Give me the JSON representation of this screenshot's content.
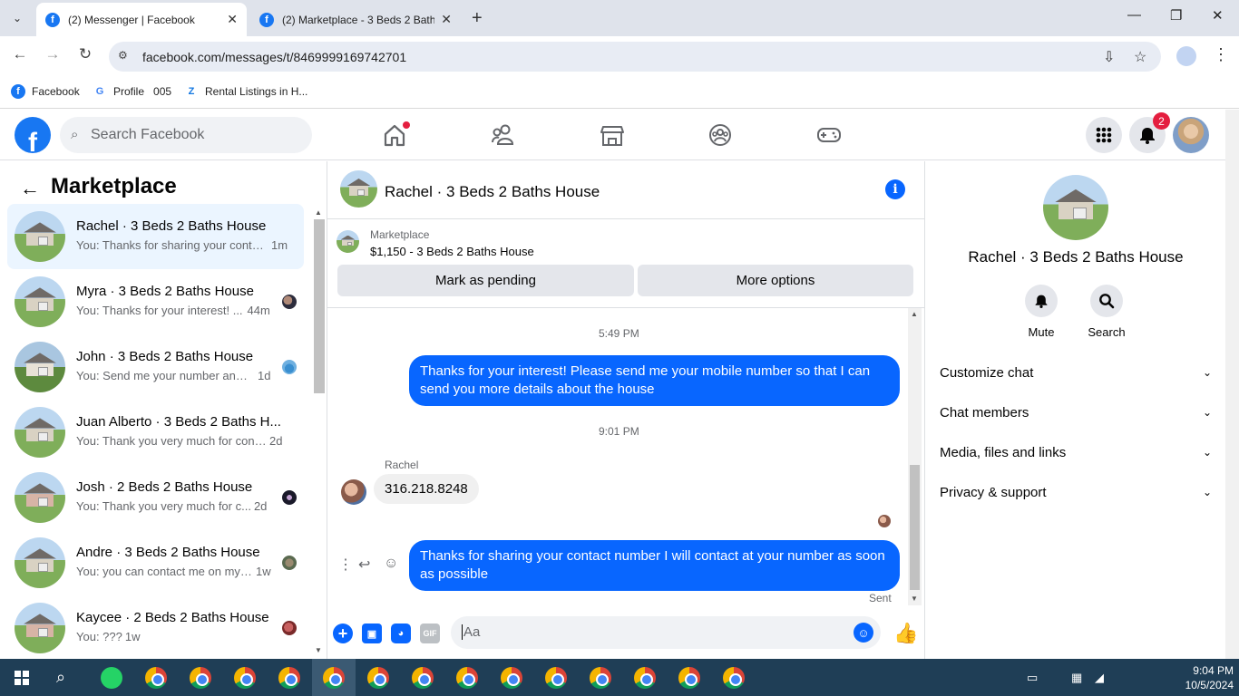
{
  "browser": {
    "tabs": [
      {
        "title": "(2) Messenger | Facebook",
        "active": true
      },
      {
        "title": "(2) Marketplace - 3 Beds 2 Bath",
        "active": false
      }
    ],
    "url": "facebook.com/messages/t/8469999169742701",
    "bookmarks": [
      {
        "label": "Facebook",
        "icon": "facebook-icon"
      },
      {
        "label": "Profile   005",
        "icon": "google-icon"
      },
      {
        "label": "Rental Listings in H...",
        "icon": "zillow-icon"
      }
    ]
  },
  "fb_header": {
    "search_placeholder": "Search Facebook",
    "notification_count": "2",
    "colors": {
      "brand": "#1877f2",
      "badge": "#e41e3f"
    }
  },
  "left_panel": {
    "title": "Marketplace",
    "conversations": [
      {
        "name": "Rachel · 3 Beds 2 Baths House",
        "preview": "You: Thanks for sharing your conta...",
        "time": "1m",
        "selected": true
      },
      {
        "name": "Myra · 3 Beds 2 Baths House",
        "preview": "You: Thanks for your interest! ...",
        "time": "44m"
      },
      {
        "name": "John · 3 Beds 2 Baths House",
        "preview": "You: Send me your number and ...",
        "time": "1d"
      },
      {
        "name": "Juan Alberto · 3 Beds 2 Baths H...",
        "preview": "You: Thank you very much for cont...",
        "time": "2d"
      },
      {
        "name": "Josh · 2 Beds 2 Baths House",
        "preview": "You: Thank you very much for c...",
        "time": "2d"
      },
      {
        "name": "Andre · 3 Beds 2 Baths House",
        "preview": "You: you can contact me on my ...",
        "time": "1w"
      },
      {
        "name": "Kaycee · 2 Beds 2 Baths House",
        "preview": "You: ???",
        "time": "1w"
      }
    ]
  },
  "chat": {
    "title": "Rachel · 3 Beds 2 Baths House",
    "marketplace_label": "Marketplace",
    "listing": "$1,150 - 3 Beds 2 Baths House",
    "mark_pending": "Mark as pending",
    "more_options": "More options",
    "messages": {
      "time1": "5:49 PM",
      "out1": "Thanks for your interest! Please send me your mobile number so that I can send you more details about the house",
      "time2": "9:01 PM",
      "sender": "Rachel",
      "in1": "316.218.8248",
      "out2": "Thanks for sharing your contact number I will contact at your number as soon as possible",
      "status": "Sent"
    },
    "composer_placeholder": "Aa",
    "accent": "#0866ff"
  },
  "right_panel": {
    "name": "Rachel · 3 Beds 2 Baths House",
    "actions": [
      {
        "label": "Mute"
      },
      {
        "label": "Search"
      }
    ],
    "sections": [
      "Customize chat",
      "Chat members",
      "Media, files and links",
      "Privacy & support"
    ]
  },
  "taskbar": {
    "time": "9:04 PM",
    "date": "10/5/2024"
  }
}
